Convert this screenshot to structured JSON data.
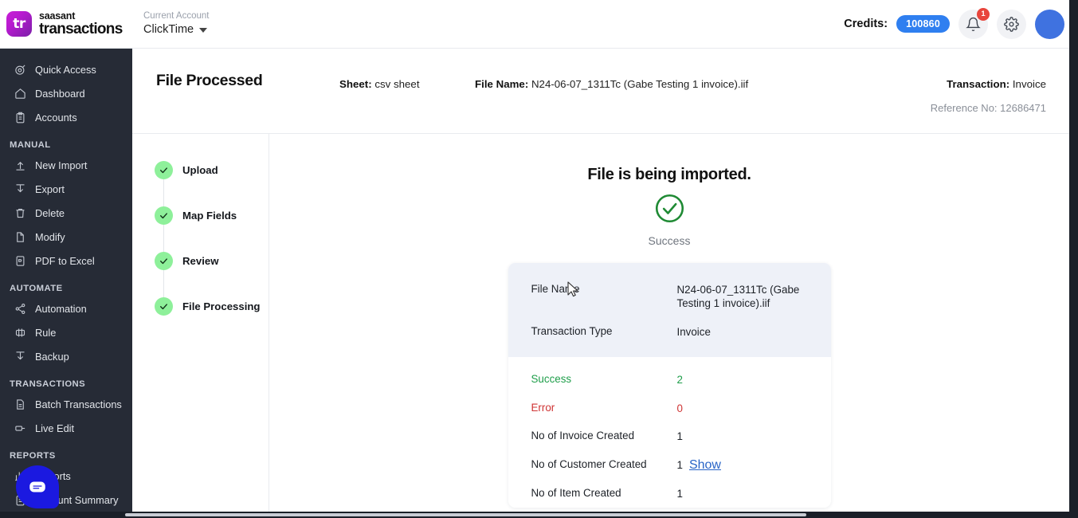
{
  "brand": {
    "line1": "saasant",
    "line2": "transactions",
    "logo_text": "tr",
    "logo_color": "#b81ad0"
  },
  "topbar": {
    "account_label": "Current Account",
    "account_value": "ClickTime",
    "credits_label": "Credits:",
    "credits_value": "100860",
    "credits_color": "#2f7ff0",
    "notification_count": "1",
    "notification_color": "#e8453c",
    "bell_icon": "bell-icon",
    "gear_icon": "gear-icon",
    "avatar_color": "#3f72e0"
  },
  "sidebar": {
    "items": [
      {
        "label": "Quick Access",
        "icon": "target-icon"
      },
      {
        "label": "Dashboard",
        "icon": "home-icon"
      },
      {
        "label": "Accounts",
        "icon": "clipboard-icon"
      }
    ],
    "groups": [
      {
        "title": "MANUAL",
        "items": [
          {
            "label": "New Import",
            "icon": "upload-icon"
          },
          {
            "label": "Export",
            "icon": "download-icon"
          },
          {
            "label": "Delete",
            "icon": "trash-icon"
          },
          {
            "label": "Modify",
            "icon": "file-edit-icon"
          },
          {
            "label": "PDF to Excel",
            "icon": "pdf-icon"
          }
        ]
      },
      {
        "title": "AUTOMATE",
        "items": [
          {
            "label": "Automation",
            "icon": "share-icon"
          },
          {
            "label": "Rule",
            "icon": "rule-icon"
          },
          {
            "label": "Backup",
            "icon": "download-icon"
          }
        ]
      },
      {
        "title": "TRANSACTIONS",
        "items": [
          {
            "label": "Batch Transactions",
            "icon": "document-icon"
          },
          {
            "label": "Live Edit",
            "icon": "live-edit-icon"
          }
        ]
      },
      {
        "title": "REPORTS",
        "items": [
          {
            "label": "Reports",
            "icon": "chart-icon"
          },
          {
            "label": "Account Summary",
            "icon": "clipboard-icon"
          }
        ]
      }
    ],
    "chat_icon": "chat-bubble-icon",
    "chat_color": "#1b19e0"
  },
  "page": {
    "title": "File Processed",
    "sheet_label": "Sheet:",
    "sheet_value": "csv sheet",
    "file_label": "File Name:",
    "file_value": "N24-06-07_1311Tc (Gabe Testing 1 invoice).iif",
    "transaction_label": "Transaction:",
    "transaction_value": "Invoice",
    "reference": "Reference No: 12686471"
  },
  "stepper": {
    "steps": [
      {
        "label": "Upload",
        "state": "complete"
      },
      {
        "label": "Map Fields",
        "state": "complete"
      },
      {
        "label": "Review",
        "state": "complete"
      },
      {
        "label": "File Processing",
        "state": "complete"
      }
    ],
    "dot_color": "#8ef09a"
  },
  "result": {
    "heading": "File is being imported.",
    "status_icon": "check-circle-icon",
    "status_color": "#1f8a34",
    "status_text": "Success",
    "rows": [
      {
        "key": "File Name",
        "value": "N24-06-07_1311Tc (Gabe Testing 1 invoice).iif",
        "section": "top"
      },
      {
        "key": "Transaction Type",
        "value": "Invoice",
        "section": "top"
      },
      {
        "key": "Success",
        "value": "2",
        "color": "#1f9e4a",
        "section": "bottom"
      },
      {
        "key": "Error",
        "value": "0",
        "color": "#cf3434",
        "section": "bottom"
      },
      {
        "key": "No of Invoice Created",
        "value": "1",
        "section": "bottom"
      },
      {
        "key": "No of Customer Created",
        "value": "1",
        "link": "Show",
        "section": "bottom"
      },
      {
        "key": "No of Item Created",
        "value": "1",
        "section": "bottom"
      }
    ]
  }
}
